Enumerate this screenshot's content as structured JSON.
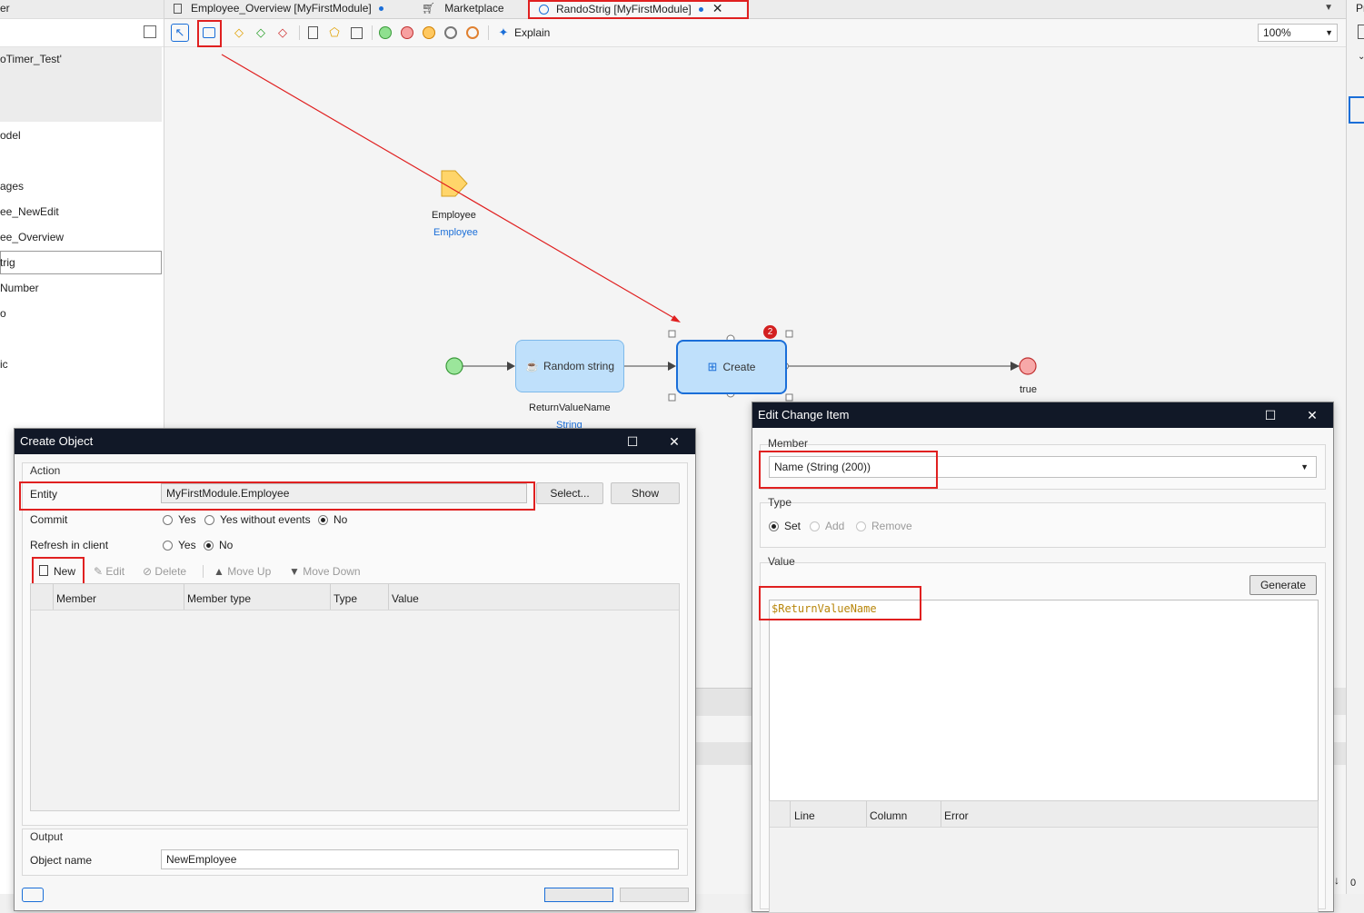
{
  "explorer": {
    "header_label": "er",
    "items": [
      {
        "label": "oTimer_Test'"
      },
      {
        "label": "odel"
      },
      {
        "label": "ages"
      },
      {
        "label": "ee_NewEdit"
      },
      {
        "label": "ee_Overview"
      },
      {
        "label": "trig"
      },
      {
        "label": "Number"
      },
      {
        "label": "o"
      },
      {
        "label": "ic"
      }
    ]
  },
  "tabs": [
    {
      "label": "Employee_Overview [MyFirstModule]",
      "icon": "page-icon",
      "unsaved": true
    },
    {
      "label": "Marketplace",
      "icon": "cart-icon",
      "unsaved": false
    },
    {
      "label": "RandoStrig [MyFirstModule]",
      "icon": "microflow-icon",
      "unsaved": true,
      "active": true
    }
  ],
  "right_strip_label": "Pr",
  "toolbar": {
    "explain_label": "Explain",
    "zoom_value": "100%"
  },
  "canvas": {
    "parameter": {
      "name": "Employee",
      "type": "Employee"
    },
    "activity1": {
      "label": "Random string",
      "output_name": "ReturnValueName",
      "output_type": "String"
    },
    "activity2": {
      "label": "Create",
      "badge": "2"
    },
    "end_label": "true"
  },
  "create_object": {
    "title": "Create Object",
    "action_group": "Action",
    "entity_label": "Entity",
    "entity_value": "MyFirstModule.Employee",
    "select_button": "Select...",
    "show_button": "Show",
    "commit_label": "Commit",
    "commit_options": [
      "Yes",
      "Yes without events",
      "No"
    ],
    "refresh_label": "Refresh in client",
    "refresh_options": [
      "Yes",
      "No"
    ],
    "toolbar": {
      "new": "New",
      "edit": "Edit",
      "delete": "Delete",
      "move_up": "Move Up",
      "move_down": "Move Down"
    },
    "columns": [
      "Member",
      "Member type",
      "Type",
      "Value"
    ],
    "output_group": "Output",
    "object_name_label": "Object name",
    "object_name_value": "NewEmployee"
  },
  "edit_change_item": {
    "title": "Edit Change Item",
    "member_group": "Member",
    "member_value": "Name (String (200))",
    "type_group": "Type",
    "type_options": [
      "Set",
      "Add",
      "Remove"
    ],
    "value_group": "Value",
    "generate_button": "Generate",
    "expression": "$ReturnValueName",
    "error_columns": [
      "Line",
      "Column",
      "Error"
    ]
  },
  "status": {
    "count": "0"
  },
  "colors": {
    "accent": "#1a6ed8",
    "annotation": "#e02020",
    "dialog_title": "#111827",
    "expression": "#b8860b"
  }
}
